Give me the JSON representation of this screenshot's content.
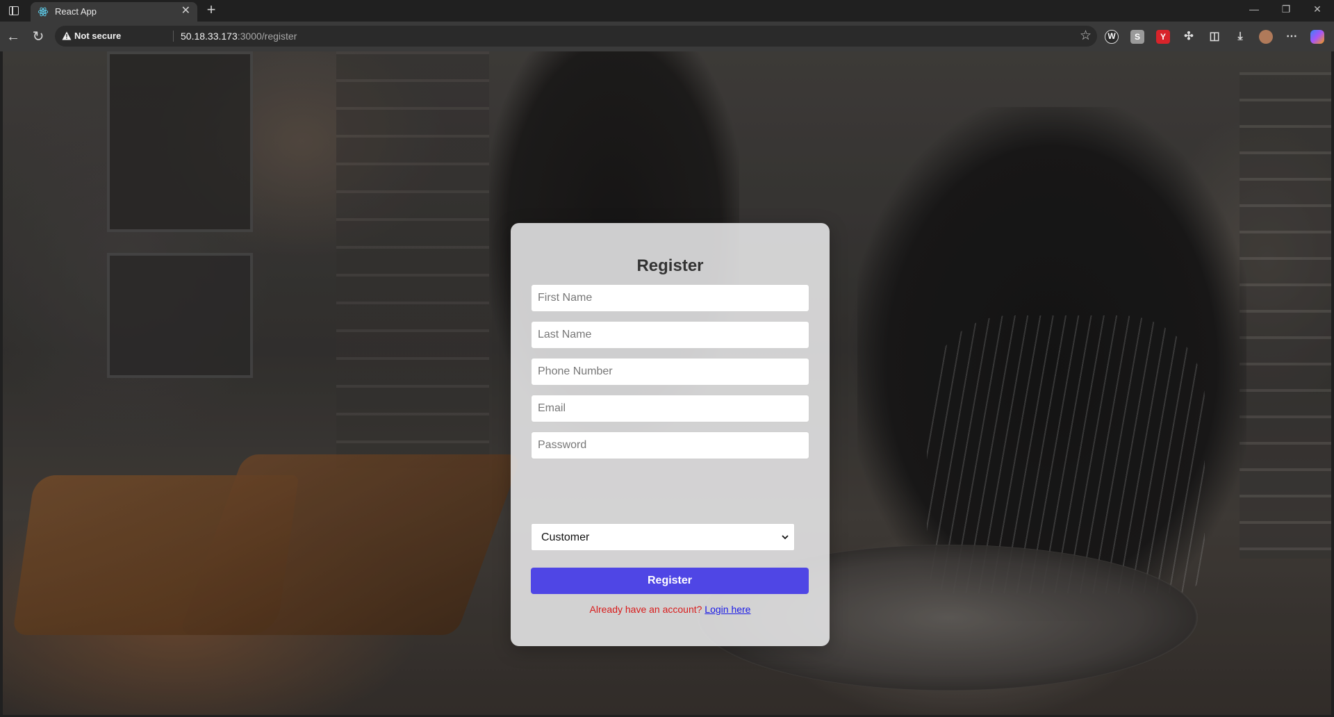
{
  "browser": {
    "tab_title": "React App",
    "security_label": "Not secure",
    "url_host": "50.18.33.173",
    "url_path": ":3000/register"
  },
  "form": {
    "title": "Register",
    "first_name_placeholder": "First Name",
    "last_name_placeholder": "Last Name",
    "phone_placeholder": "Phone Number",
    "email_placeholder": "Email",
    "password_placeholder": "Password",
    "role_selected": "Customer",
    "submit_label": "Register",
    "login_prompt": "Already have an account?",
    "login_link": "Login here"
  },
  "colors": {
    "submit_button": "#4f46e5",
    "prompt_text": "#d81b1b",
    "link_text": "#1a1ae6"
  },
  "icons": {
    "tab_favicon": "react-icon",
    "security": "warning-icon",
    "bookmark": "star-icon"
  }
}
